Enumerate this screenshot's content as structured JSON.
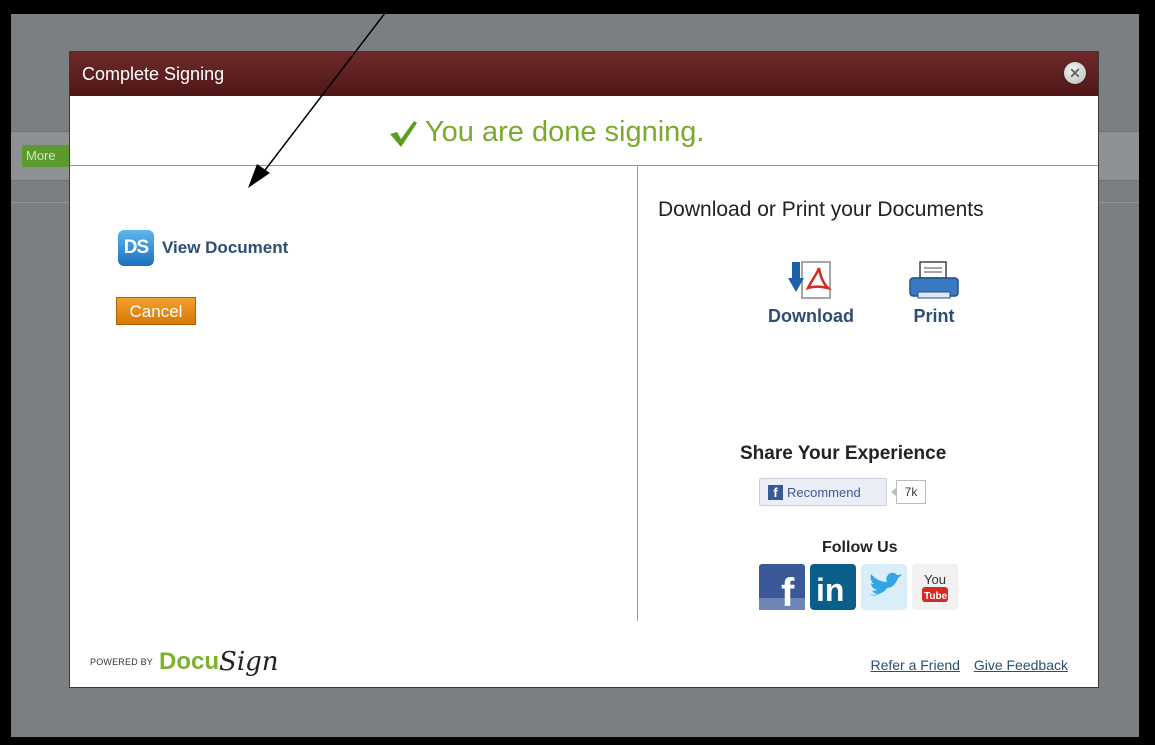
{
  "background": {
    "more_tab_label": "More"
  },
  "modal": {
    "title": "Complete Signing",
    "close_symbol": "✕",
    "done_message": "You are done signing.",
    "view_document_icon_text": "DS",
    "view_document_label": "View Document",
    "cancel_label": "Cancel",
    "download_heading": "Download or Print your Documents",
    "download_label": "Download",
    "print_label": "Print",
    "share_heading": "Share Your Experience",
    "recommend_label": "Recommend",
    "recommend_count": "7k",
    "follow_heading": "Follow Us",
    "social": {
      "facebook": "f",
      "linkedin": "in",
      "youtube_top": "You",
      "youtube_bottom": "Tube"
    },
    "powered_by": "POWERED BY",
    "brand_docu": "Docu",
    "brand_sign": "Sign",
    "refer_link": "Refer a Friend",
    "feedback_link": "Give Feedback"
  },
  "colors": {
    "titlebar": "#5b1f1f",
    "done_green": "#7aaa2b",
    "cancel_orange": "#e38a17",
    "link_blue": "#2d4e73"
  },
  "icons": [
    "close-icon",
    "checkmark-icon",
    "docusign-icon",
    "pdf-download-icon",
    "printer-icon",
    "facebook-icon",
    "linkedin-icon",
    "twitter-icon",
    "youtube-icon"
  ]
}
